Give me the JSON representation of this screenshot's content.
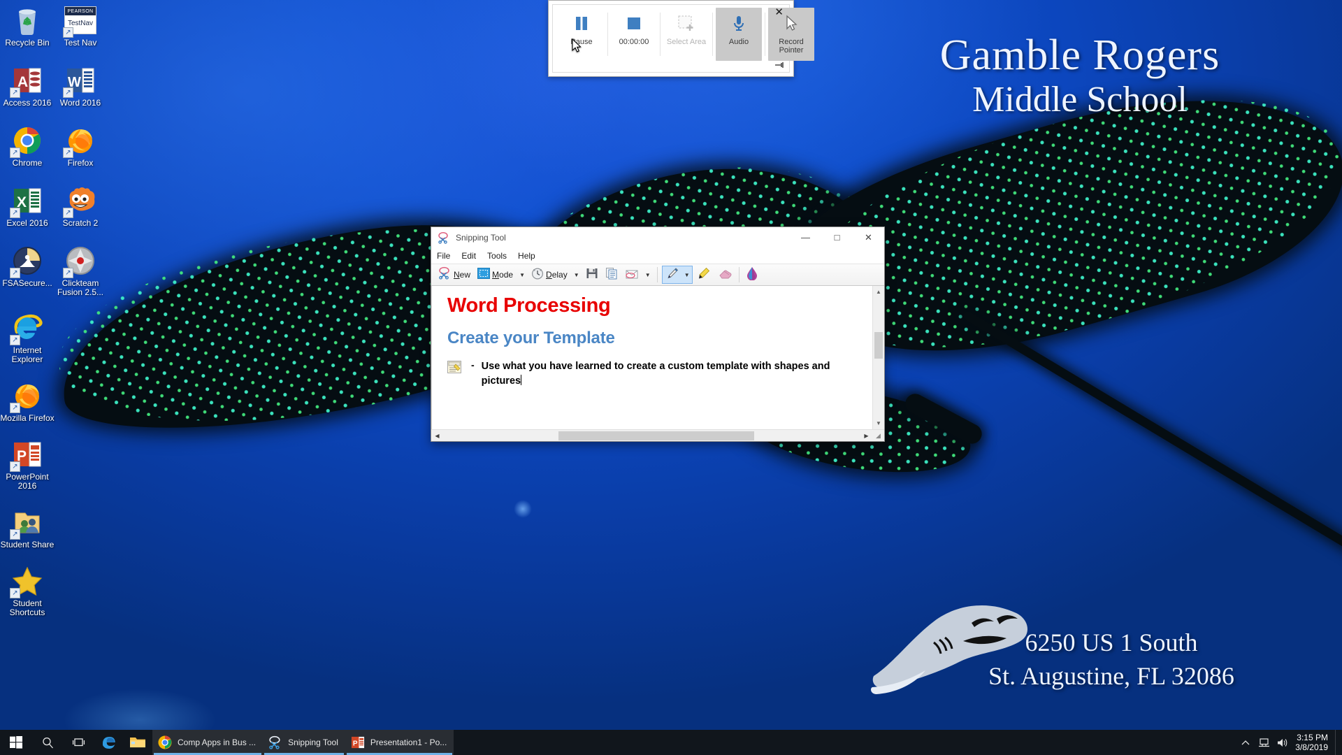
{
  "wallpaper": {
    "school_name_line1": "Gamble Rogers",
    "school_name_line2": "Middle School",
    "address_line1": "6250 US 1 South",
    "address_line2": "St. Augustine, FL 32086",
    "background_color": "#0c46bd"
  },
  "desktop_icons": [
    {
      "label": "Recycle Bin",
      "icon": "recycle-bin-icon",
      "shortcut": false
    },
    {
      "label": "Test Nav",
      "icon": "testnav-icon",
      "shortcut": true
    },
    {
      "label": "Access 2016",
      "icon": "access-icon",
      "shortcut": true
    },
    {
      "label": "Word 2016",
      "icon": "word-icon",
      "shortcut": true
    },
    {
      "label": "Chrome",
      "icon": "chrome-icon",
      "shortcut": true
    },
    {
      "label": "Firefox",
      "icon": "firefox-icon",
      "shortcut": true
    },
    {
      "label": "Excel 2016",
      "icon": "excel-icon",
      "shortcut": true
    },
    {
      "label": "Scratch 2",
      "icon": "scratch-icon",
      "shortcut": true
    },
    {
      "label": "FSASecure...",
      "icon": "fsasecure-icon",
      "shortcut": true
    },
    {
      "label": "Clickteam Fusion 2.5...",
      "icon": "clickteam-fusion-icon",
      "shortcut": true
    },
    {
      "label": "Internet Explorer",
      "icon": "internet-explorer-icon",
      "shortcut": true
    },
    {
      "label": "Mozilla Firefox",
      "icon": "firefox-icon",
      "shortcut": true
    },
    {
      "label": "PowerPoint 2016",
      "icon": "powerpoint-icon",
      "shortcut": true
    },
    {
      "label": "Student Share",
      "icon": "shared-folder-icon",
      "shortcut": true
    },
    {
      "label": "Student Shortcuts",
      "icon": "star-folder-icon",
      "shortcut": true
    }
  ],
  "testnav_badge": {
    "brand": "PEARSON",
    "name": "TestNav"
  },
  "recording_toolbar": {
    "buttons": [
      {
        "label": "Pause",
        "icon": "pause-icon",
        "state": "enabled"
      },
      {
        "label": "00:00:00",
        "icon": "stop-icon",
        "state": "enabled"
      },
      {
        "label": "Select Area",
        "icon": "select-area-icon",
        "state": "disabled"
      },
      {
        "label": "Audio",
        "icon": "microphone-icon",
        "state": "toggled-on"
      },
      {
        "label": "Record Pointer",
        "icon": "pointer-icon",
        "state": "toggled-on"
      }
    ],
    "timer": "00:00:00",
    "close_label": "✕",
    "pin_label": "➖"
  },
  "snipping_tool": {
    "title": "Snipping Tool",
    "window_controls": {
      "minimize": "—",
      "maximize": "□",
      "close": "✕"
    },
    "menu": [
      "File",
      "Edit",
      "Tools",
      "Help"
    ],
    "toolbar": [
      {
        "label": "New",
        "icon": "scissors-icon",
        "accesskey": "N",
        "has_caret": false
      },
      {
        "label": "Mode",
        "icon": "mode-icon",
        "accesskey": "M",
        "has_caret": true
      },
      {
        "label": "Delay",
        "icon": "clock-icon",
        "accesskey": "D",
        "has_caret": true
      },
      {
        "label": "Save Snip",
        "icon": "save-disk-icon",
        "has_caret": false
      },
      {
        "label": "Copy",
        "icon": "copy-icon",
        "has_caret": false
      },
      {
        "label": "Send Snip",
        "icon": "email-icon",
        "has_caret": true
      },
      {
        "label": "Pen",
        "icon": "pen-icon",
        "has_caret": true
      },
      {
        "label": "Highlighter",
        "icon": "highlighter-icon",
        "has_caret": false
      },
      {
        "label": "Eraser",
        "icon": "eraser-icon",
        "has_caret": false
      },
      {
        "label": "Ink Tools",
        "icon": "ink-drop-icon",
        "has_caret": false
      }
    ],
    "snip_content": {
      "heading": "Word Processing",
      "subheading": "Create your Template",
      "bullet_dash": "-",
      "bullet_text": "Use what you have learned to create a custom template with shapes and pictures",
      "heading_color": "#e80000",
      "subheading_color": "#4a86c5"
    }
  },
  "taskbar": {
    "start_label": "Start",
    "search_label": "Search",
    "taskview_label": "Task View",
    "pinned": [
      {
        "label": "Microsoft Edge",
        "icon": "edge-icon",
        "open": false
      },
      {
        "label": "File Explorer",
        "icon": "folder-icon",
        "open": false
      }
    ],
    "apps": [
      {
        "label": "Comp Apps in Bus ...",
        "icon": "chrome-icon",
        "open": true
      },
      {
        "label": "Snipping Tool",
        "icon": "snipping-tool-icon",
        "open": true
      },
      {
        "label": "Presentation1 - Po...",
        "icon": "powerpoint-icon",
        "open": true
      }
    ],
    "tray": [
      {
        "label": "Show hidden icons",
        "icon": "chevron-up-icon"
      },
      {
        "label": "Network",
        "icon": "network-icon"
      },
      {
        "label": "Volume",
        "icon": "speaker-icon"
      }
    ],
    "clock_time": "3:15 PM",
    "clock_date": "3/8/2019"
  }
}
